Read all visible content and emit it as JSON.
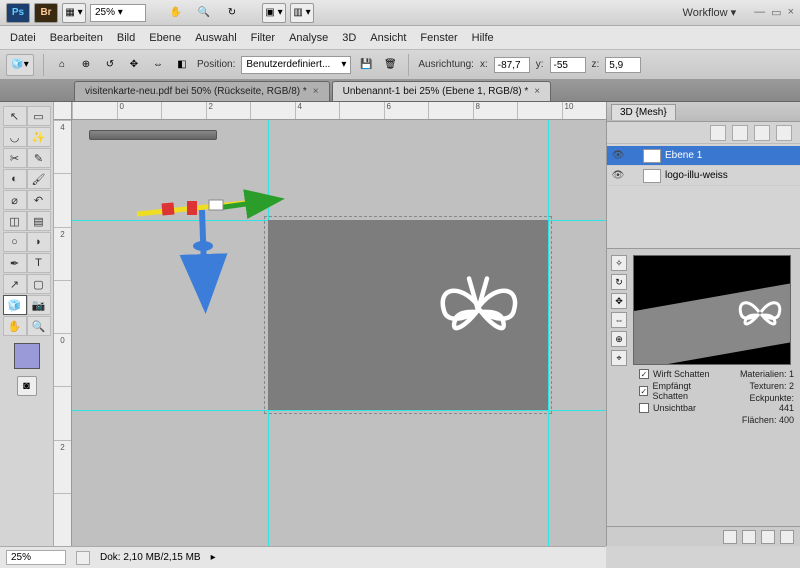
{
  "appbar": {
    "ps": "Ps",
    "br": "Br",
    "zoom": "25%  ▾",
    "workflow": "Workflow ▾"
  },
  "menu": [
    "Datei",
    "Bearbeiten",
    "Bild",
    "Ebene",
    "Auswahl",
    "Filter",
    "Analyse",
    "3D",
    "Ansicht",
    "Fenster",
    "Hilfe"
  ],
  "optbar": {
    "positionLabel": "Position:",
    "positionValue": "Benutzerdefiniert...",
    "ausrichtung": "Ausrichtung:",
    "xLabel": "x:",
    "xVal": "-87,7",
    "yLabel": "y:",
    "yVal": "-55",
    "zLabel": "z:",
    "zVal": "5,9"
  },
  "tabs": [
    {
      "label": "visitenkarte-neu.pdf bei 50% (Rückseite, RGB/8) *",
      "active": false,
      "close": "×"
    },
    {
      "label": "Unbenannt-1 bei 25% (Ebene 1, RGB/8) *",
      "active": true,
      "close": "×"
    }
  ],
  "rulerH": [
    "",
    "0",
    "",
    "2",
    "",
    "4",
    "",
    "6",
    "",
    "8",
    "",
    "10"
  ],
  "rulerV": [
    "4",
    "",
    "2",
    "",
    "0",
    "",
    "2",
    ""
  ],
  "panel": {
    "title": "3D {Mesh}",
    "layers": [
      {
        "name": "Ebene 1",
        "sel": true
      },
      {
        "name": "logo-illu-weiss",
        "sel": false
      }
    ],
    "chk1": "Wirft Schatten",
    "chk2": "Empfängt Schatten",
    "chk3": "Unsichtbar",
    "matLabel": "Materialien:",
    "matVal": "1",
    "texLabel": "Texturen:",
    "texVal": "2",
    "eckLabel": "Eckpunkte:",
    "eckVal": "441",
    "flLabel": "Flächen:",
    "flVal": "400"
  },
  "status": {
    "zoom": "25%",
    "dok": "Dok: 2,10 MB/2,15 MB"
  }
}
